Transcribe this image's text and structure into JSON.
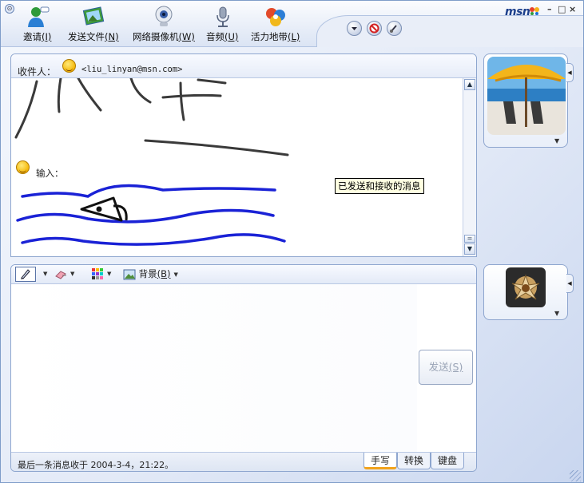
{
  "toolbar": {
    "items": [
      {
        "label": "邀请",
        "shortcut": "(I)",
        "icon": "invite-person-icon"
      },
      {
        "label": "发送文件",
        "shortcut": "(N)",
        "icon": "send-file-icon"
      },
      {
        "label": "网络摄像机",
        "shortcut": "(W)",
        "icon": "webcam-icon"
      },
      {
        "label": "音频",
        "shortcut": "(U)",
        "icon": "microphone-icon"
      },
      {
        "label": "活力地带",
        "shortcut": "(L)",
        "icon": "activities-icon"
      }
    ],
    "logo": "msn",
    "window_controls": {
      "minimize": "–",
      "maximize": "□",
      "close": "×"
    }
  },
  "conversation": {
    "recipient_label": "收件人：",
    "recipient_email": "<liu_linyan@msn.com>",
    "input_label": "输入：",
    "tooltip": "已发送和接收的消息",
    "ink_color": "#1a22d6"
  },
  "compose": {
    "background_label": "背景",
    "background_shortcut": "(B)",
    "send_label": "发送",
    "send_shortcut": "(S)",
    "status": "最后一条消息收于 2004-3-4，21:22。",
    "mode_tabs": [
      "手写",
      "转换",
      "键盘"
    ],
    "active_tab": 0
  },
  "colors": {
    "accent": "#f2a31b",
    "frame": "#8ea6cf",
    "ink_blue": "#1a22d6"
  }
}
